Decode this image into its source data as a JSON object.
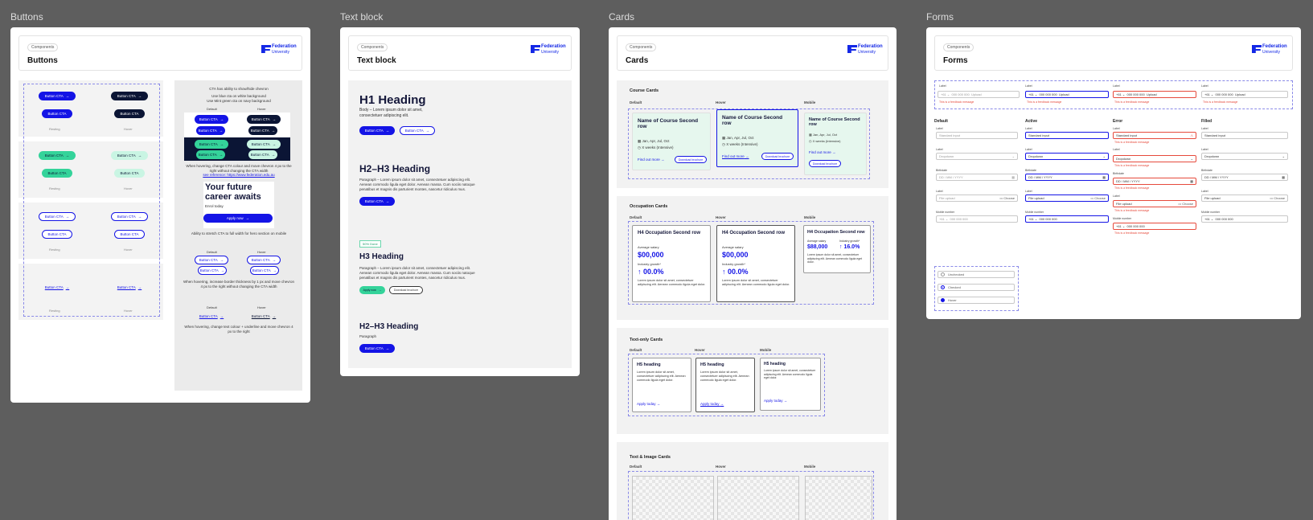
{
  "frames": {
    "buttons": "Buttons",
    "text_block": "Text block",
    "cards": "Cards",
    "forms": "Forms"
  },
  "header": {
    "chip": "Components",
    "logo_line1": "Federation",
    "logo_line2": "University"
  },
  "buttons": {
    "cta": "Button CTA",
    "arrow": "→",
    "state_default": "Resting",
    "state_hover": "Hover",
    "notes": {
      "n1": "CTA has ability to show/hide chevron",
      "n2": "Use blue cta on white background",
      "n3": "Use Mint green cta on navy background",
      "default": "Default",
      "hover": "Hover",
      "n4": "When hovering, change CTA colour and move chevron 4 px to the right without changing the CTA width",
      "n4_link": "see reference: https://www.federation.edu.au",
      "promo_title": "Your future career awaits",
      "promo_sub": "Enrol today",
      "promo_btn": "Apply now",
      "n5": "Ability to stretch CTA to full width for hero section on mobile",
      "n6": "When hovering, increase border thickness by 1 px and move chevron 4 px to the right without changing the CTA width",
      "n7": "When hovering, change text colour + underline and move chevron 4 px to the right"
    }
  },
  "textblock": {
    "h1": "H1 Heading",
    "body": "Body – Lorem ipsum dolor sit amet, consectetuer adipiscing elit.",
    "h2a": "H2–H3 Heading",
    "para": "Paragraph – Lorem ipsum dolor sit amet, consectetuer adipiscing elit. Aenean commodo ligula eget dolor. Aenean massa. Cum sociis natoque penatibus et magnis dis parturient montes, nascetur ridiculus mus.",
    "tag": "50% Done",
    "h3": "H3 Heading",
    "apply": "Apply now",
    "download": "Download brochure",
    "h2b": "H2–H3 Heading",
    "para_short": "Paragraph"
  },
  "cards": {
    "course_title": "Course Cards",
    "occupation_title": "Occupation Cards",
    "textonly_title": "Text-only Cards",
    "textimage_title": "Text & Image Cards",
    "col_default": "Default",
    "col_hover": "Hover",
    "col_mobile": "Mobile",
    "course_name": "Name of Course Second row",
    "course_intake": "Jan, Apr, Jul, Oct",
    "course_duration": "X weeks (Intensive)",
    "find_more": "Find out more",
    "download": "Download brochure",
    "occ_name": "H4 Occupation Second row",
    "avg_salary": "Average salary",
    "salary": "$00,000",
    "growth_label": "Industry growth*",
    "growth": "00.0%",
    "mobile_salary": "$88,000",
    "mobile_growth": "16.0%",
    "occ_desc": "Lorem ipsum dolor sit amet, consectetuer adipiscing elit. Aenean commodo ligula eget dolor.",
    "h5": "H5 heading",
    "h5_desc": "Lorem ipsum dolor sit amet, consectetuer adipiscing elit. Aenean commodo ligula eget dolor.",
    "apply_today": "Apply today"
  },
  "forms": {
    "label": "Label",
    "code": "+61",
    "phone_ph": "000 000 000",
    "upload": "Upload",
    "feedback": "This is a feedback message",
    "col_default": "Default",
    "col_active": "Active",
    "col_error": "Error",
    "col_filled": "Filled",
    "standard_input": "Standard input",
    "dropdown": "Dropdown",
    "birthdate": "Birthdate",
    "date_ph": "DD / MM / YYYY",
    "file_upload": "File upload",
    "choose": "Choose",
    "mobile_number": "Mobile number",
    "unchecked": "Unchecked",
    "checked": "Checked",
    "hover": "Hover"
  },
  "colors": {
    "blue": "#1414e6",
    "navy": "#0b1535",
    "mint": "#34d39a",
    "error": "#e64a3c"
  }
}
